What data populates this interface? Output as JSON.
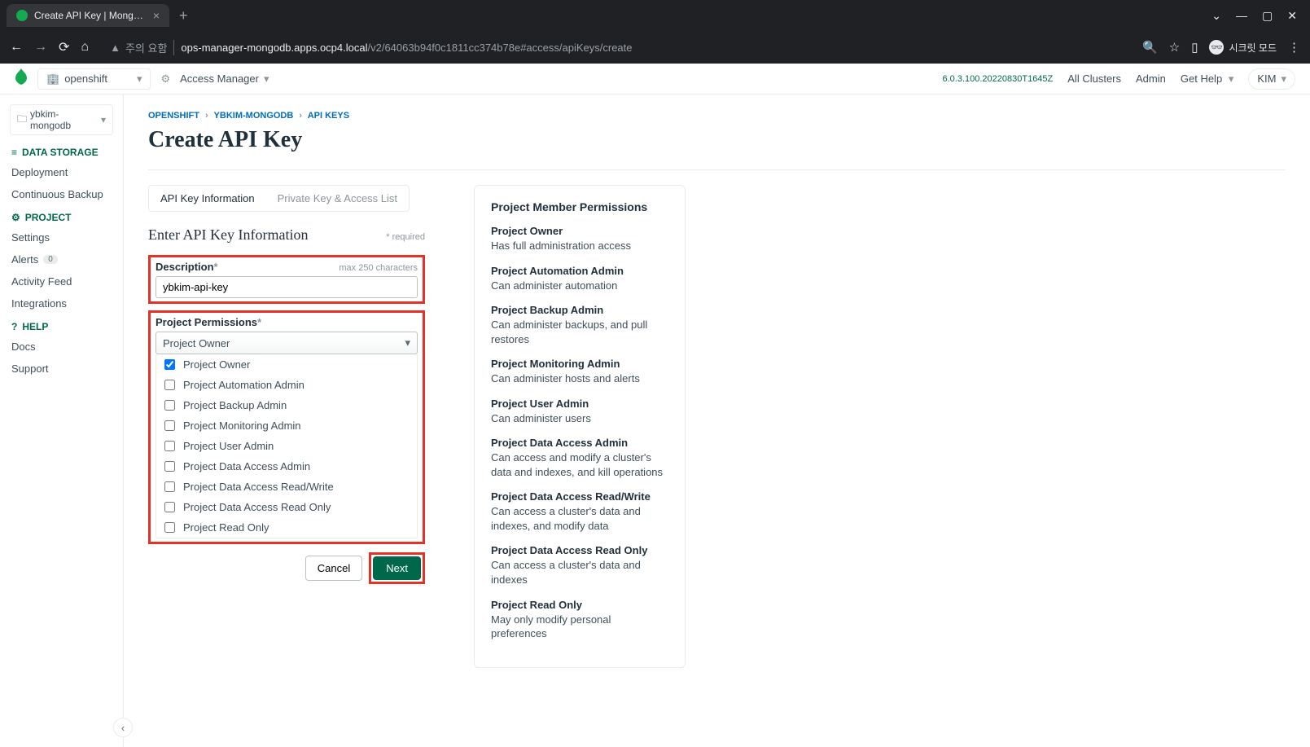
{
  "browser": {
    "tab_title": "Create API Key | MongoDB Ops",
    "url_warning": "주의 요함",
    "url_host": "ops-manager-mongodb.apps.ocp4.local",
    "url_path": "/v2/64063b94f0c1811cc374b78e#access/apiKeys/create",
    "incognito_label": "시크릿 모드"
  },
  "header": {
    "org": "openshift",
    "access_manager": "Access Manager",
    "version": "6.0.3.100.20220830T1645Z",
    "all_clusters": "All Clusters",
    "admin": "Admin",
    "get_help": "Get Help",
    "user": "KIM"
  },
  "sidebar": {
    "project": "ybkim-mongodb",
    "sections": {
      "data_storage": "DATA STORAGE",
      "project": "PROJECT",
      "help": "HELP"
    },
    "items": {
      "deployment": "Deployment",
      "continuous_backup": "Continuous Backup",
      "settings": "Settings",
      "alerts": "Alerts",
      "alerts_badge": "0",
      "activity_feed": "Activity Feed",
      "integrations": "Integrations",
      "docs": "Docs",
      "support": "Support"
    }
  },
  "breadcrumb": {
    "org": "OPENSHIFT",
    "project": "YBKIM-MONGODB",
    "section": "API KEYS"
  },
  "page": {
    "title": "Create API Key",
    "wizard_tab1": "API Key Information",
    "wizard_tab2": "Private Key & Access List",
    "section_title": "Enter API Key Information",
    "required_hint": "* required",
    "desc_label": "Description",
    "desc_hint": "max 250 characters",
    "desc_value": "ybkim-api-key",
    "perm_label": "Project Permissions",
    "perm_selected": "Project Owner",
    "cancel": "Cancel",
    "next": "Next"
  },
  "permissions": [
    {
      "label": "Project Owner",
      "checked": true
    },
    {
      "label": "Project Automation Admin",
      "checked": false
    },
    {
      "label": "Project Backup Admin",
      "checked": false
    },
    {
      "label": "Project Monitoring Admin",
      "checked": false
    },
    {
      "label": "Project User Admin",
      "checked": false
    },
    {
      "label": "Project Data Access Admin",
      "checked": false
    },
    {
      "label": "Project Data Access Read/Write",
      "checked": false
    },
    {
      "label": "Project Data Access Read Only",
      "checked": false
    },
    {
      "label": "Project Read Only",
      "checked": false
    }
  ],
  "panel": {
    "title": "Project Member Permissions",
    "defs": [
      {
        "title": "Project Owner",
        "desc": "Has full administration access"
      },
      {
        "title": "Project Automation Admin",
        "desc": "Can administer automation"
      },
      {
        "title": "Project Backup Admin",
        "desc": "Can administer backups, and pull restores"
      },
      {
        "title": "Project Monitoring Admin",
        "desc": "Can administer hosts and alerts"
      },
      {
        "title": "Project User Admin",
        "desc": "Can administer users"
      },
      {
        "title": "Project Data Access Admin",
        "desc": "Can access and modify a cluster's data and indexes, and kill operations"
      },
      {
        "title": "Project Data Access Read/Write",
        "desc": "Can access a cluster's data and indexes, and modify data"
      },
      {
        "title": "Project Data Access Read Only",
        "desc": "Can access a cluster's data and indexes"
      },
      {
        "title": "Project Read Only",
        "desc": "May only modify personal preferences"
      }
    ]
  }
}
